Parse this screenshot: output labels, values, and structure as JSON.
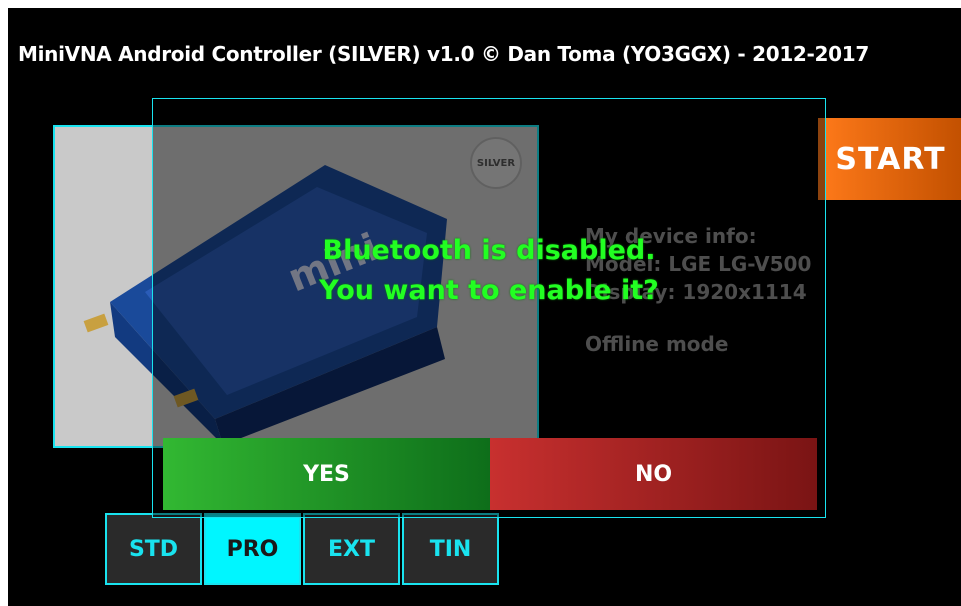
{
  "app": {
    "title": "MiniVNA Android Controller (SILVER) v1.0   © Dan Toma (YO3GGX) - 2012-2017"
  },
  "device": {
    "badge": "SILVER"
  },
  "info": {
    "title": "My device info:",
    "model": "Model: LGE LG-V500",
    "display": "Display: 1920x1114",
    "mode": "Offline mode"
  },
  "start_label": "START",
  "tabs": [
    {
      "label": "STD",
      "active": false
    },
    {
      "label": "PRO",
      "active": true
    },
    {
      "label": "EXT",
      "active": false
    },
    {
      "label": "TIN",
      "active": false
    }
  ],
  "dialog": {
    "line1": "Bluetooth is disabled.",
    "line2": "You want to enable it?",
    "yes_label": "YES",
    "no_label": "NO"
  },
  "colors": {
    "accent": "#19e3ef",
    "start": "#f07018",
    "yes": "#2eaa33",
    "no": "#c0302e",
    "message": "#22ff22"
  }
}
